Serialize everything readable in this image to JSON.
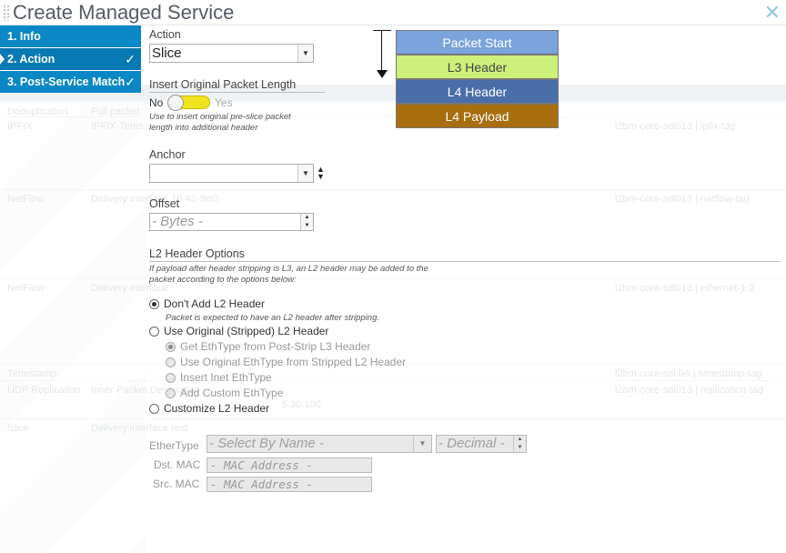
{
  "title": "Create Managed Service",
  "steps": [
    {
      "label": "1. Info",
      "checked": false
    },
    {
      "label": "2. Action",
      "checked": true
    },
    {
      "label": "3. Post-Service Match",
      "checked": true
    }
  ],
  "check_glyph": "✓",
  "close_glyph": "✕",
  "action": {
    "label": "Action",
    "value": "Slice"
  },
  "insert_len": {
    "label": "Insert Original Packet Length",
    "no": "No",
    "yes": "Yes",
    "help": "Use to insert original pre-slice packet length into additional header"
  },
  "anchor": {
    "label": "Anchor",
    "value": ""
  },
  "offset": {
    "label": "Offset",
    "placeholder": "- Bytes -"
  },
  "l2": {
    "label": "L2 Header Options",
    "help": "If payload after header stripping is L3, an L2 header may be added to the packet according to the options below:",
    "options": [
      {
        "label": "Don't Add L2 Header",
        "selected": true
      },
      {
        "label": "Use Original (Stripped) L2 Header",
        "selected": false
      },
      {
        "label": "Customize L2 Header",
        "selected": false
      }
    ],
    "option0_help": "Packet is expected to have an L2 header after stripping.",
    "sub_options": [
      {
        "label": "Get EthType from Post-Strip L3 Header",
        "selected": true
      },
      {
        "label": "Use Original EthType from Stripped L2 Header",
        "selected": false
      },
      {
        "label": "Insert Inet EthType",
        "selected": false
      },
      {
        "label": "Add Custom EthType",
        "selected": false
      }
    ]
  },
  "custom": {
    "ethertype_label": "EtherType",
    "ethertype_placeholder": "- Select By Name -",
    "decimal_placeholder": "- Decimal -",
    "dst_label": "Dst. MAC",
    "src_label": "Src. MAC",
    "mac_placeholder": "- MAC Address -"
  },
  "diagram": [
    {
      "label": "Packet Start",
      "color": "#7ba3dc",
      "text": "#ffffff"
    },
    {
      "label": "L3 Header",
      "color": "#ccf07a",
      "text": "#444444"
    },
    {
      "label": "L4 Header",
      "color": "#4a6ea8",
      "text": "#ffffff"
    },
    {
      "label": "L4 Payload",
      "color": "#a86e0e",
      "text": "#ffffff"
    }
  ],
  "background_rows": [
    {
      "c1": "Deduplication",
      "c2": "Full packet",
      "c3": "",
      "c5": ""
    },
    {
      "c1": "IPFIX",
      "c2": "IPFIX-Tems",
      "c3": "",
      "c5": "l2bm-core-sdl013 | ipfix-tag"
    },
    {
      "c1": "NetFlow",
      "c2": "Delivery interface 10-42-9m3",
      "c3": "",
      "c5": "l2bm-core-sdl013 | netflow-tag"
    },
    {
      "c1": "NetFlow",
      "c2": "Delivery interface",
      "c3": "",
      "c5": "l2bm-core-sdl013 | ethernet-1-2"
    },
    {
      "c1": "Timestamp",
      "c2": "",
      "c3": "",
      "c5": "l2bm-core-sdl 0A | timestamp-tag"
    },
    {
      "c1": "UDP Replication",
      "c2": "Inner Packet Destination",
      "c3": "5.30.100",
      "c5": "l2bm-core-sdl013 | replication-tag"
    },
    {
      "c1": "Slice",
      "c2": "Delivery interface test",
      "c3": "",
      "c5": ""
    }
  ]
}
